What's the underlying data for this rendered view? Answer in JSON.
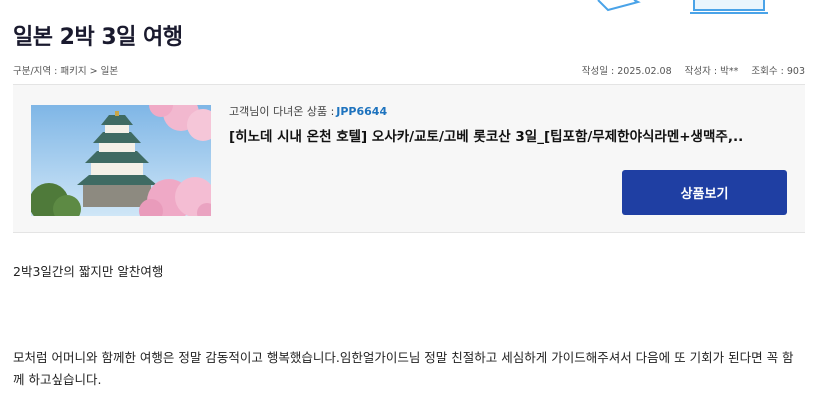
{
  "page": {
    "title": "일본 2박 3일 여행"
  },
  "breadcrumb": {
    "label": "구분/지역 :",
    "category": "패키지",
    "separator": ">",
    "region": "일본"
  },
  "meta": {
    "date_label": "작성일 : 2025.02.08",
    "author_label": "작성자 : 박**",
    "views_label": "조회수 : 903"
  },
  "product": {
    "visited_label": "고객님이 다녀온 상품 :",
    "code": "JPP6644",
    "name": "[히노데 시내 온천 호텔] 오사카/교토/고베 롯코산 3일_[팁포함/무제한야식라멘+생맥주,..",
    "button_label": "상품보기",
    "image_icon": "osaka-castle-photo"
  },
  "content": {
    "paragraph_1": "2박3일간의 짧지만 알찬여행",
    "paragraph_2": " 모처럼 어머니와 함께한 여행은 정말 감동적이고 행복했습니다.임한얼가이드님 정말 친절하고 세심하게 가이드해주셔서 다음에 또 기회가 된다면 꼭 함께 하고싶습니다."
  },
  "colors": {
    "accent": "#1f3fa3",
    "code": "#1e73be",
    "box_bg": "#f7f7f7"
  }
}
